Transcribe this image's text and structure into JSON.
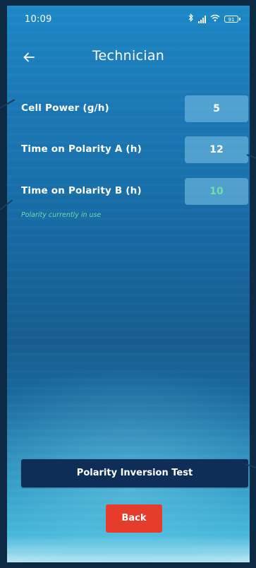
{
  "status_bar": {
    "time": "10:09",
    "bluetooth_icon": "bluetooth-icon",
    "signal_icon": "signal-bars-icon",
    "wifi_icon": "wifi-icon",
    "battery_level": "91"
  },
  "header": {
    "back_icon": "back-arrow-icon",
    "title": "Technician"
  },
  "settings": [
    {
      "label": "Cell Power (g/h)",
      "value": "5",
      "active": false
    },
    {
      "label": "Time on Polarity A (h)",
      "value": "12",
      "active": false
    },
    {
      "label": "Time on Polarity B (h)",
      "value": "10",
      "active": true
    }
  ],
  "active_note": "Polarity currently in use",
  "buttons": {
    "polarity_test_label": "Polarity Inversion Test",
    "back_label": "Back"
  },
  "colors": {
    "active_value": "#6fe0a6",
    "primary_button": "#0e2d57",
    "back_button": "#e53c2c"
  }
}
